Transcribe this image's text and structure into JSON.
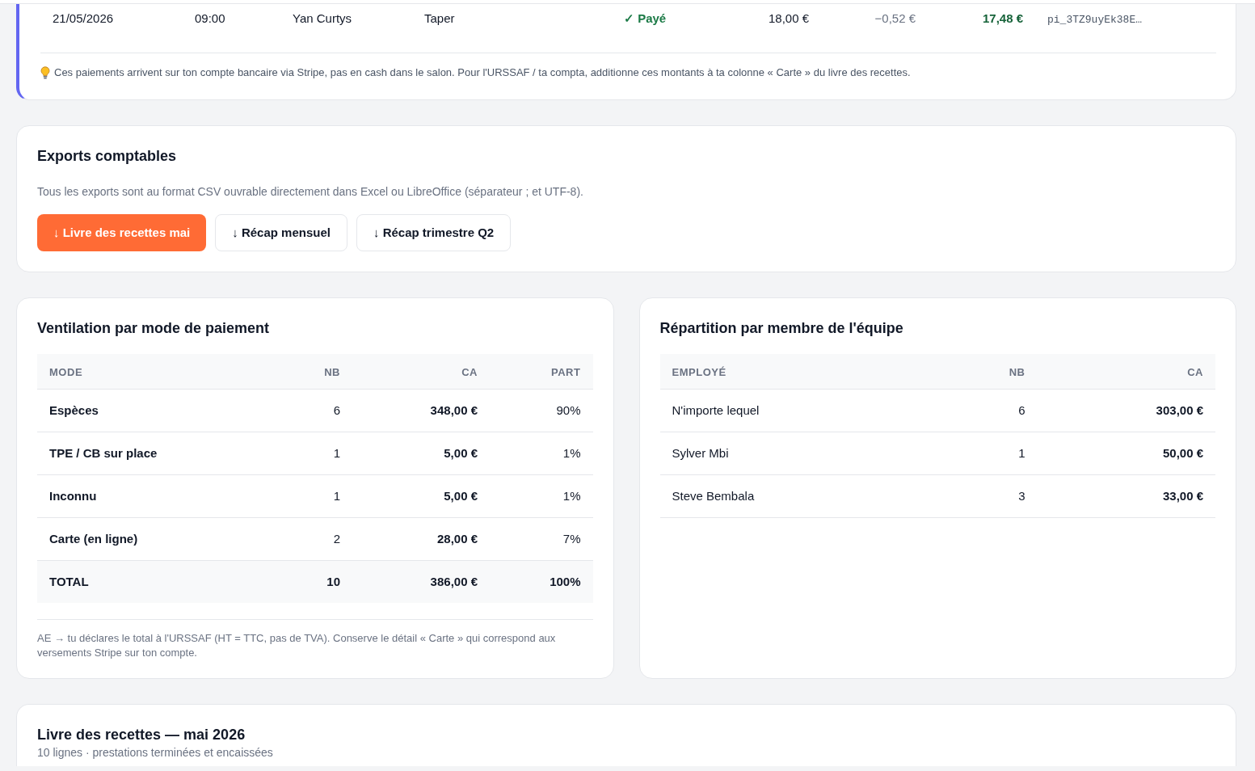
{
  "stripe_payments": {
    "rows": [
      {
        "cells": [
          {
            "text": "21/05/2026",
            "kind": "text"
          },
          {
            "text": "09:00",
            "kind": "text"
          },
          {
            "text": "Yan Curtys",
            "kind": "text"
          },
          {
            "text": "Taper",
            "kind": "text"
          },
          {
            "text": "✓ Payé",
            "kind": "status"
          },
          {
            "text": "18,00 €",
            "kind": "amount"
          },
          {
            "text": "−0,52 €",
            "kind": "fee"
          },
          {
            "text": "17,48 €",
            "kind": "net"
          },
          {
            "text": "pi_3TZ9uyEk38E…",
            "kind": "ref"
          }
        ]
      }
    ],
    "note": "Ces paiements arrivent sur ton compte bancaire via Stripe, pas en cash dans le salon. Pour l'URSSAF / ta compta, additionne ces montants à ta colonne « Carte » du livre des recettes."
  },
  "exports": {
    "title": "Exports comptables",
    "description": "Tous les exports sont au format CSV ouvrable directement dans Excel ou LibreOffice (séparateur ; et UTF-8).",
    "buttons": [
      {
        "label": "↓ Livre des recettes mai",
        "primary": true
      },
      {
        "label": "↓ Récap mensuel",
        "primary": false
      },
      {
        "label": "↓ Récap trimestre Q2",
        "primary": false
      }
    ]
  },
  "payment_breakdown": {
    "title": "Ventilation par mode de paiement",
    "columns": [
      "MODE",
      "NB",
      "CA",
      "PART"
    ],
    "rows": [
      [
        "Espèces",
        "6",
        "348,00 €",
        "90%"
      ],
      [
        "TPE / CB sur place",
        "1",
        "5,00 €",
        "1%"
      ],
      [
        "Inconnu",
        "1",
        "5,00 €",
        "1%"
      ],
      [
        "Carte (en ligne)",
        "2",
        "28,00 €",
        "7%"
      ]
    ],
    "total": [
      "TOTAL",
      "10",
      "386,00 €",
      "100%"
    ],
    "note": "AE → tu déclares le total à l'URSSAF (HT = TTC, pas de TVA). Conserve le détail « Carte » qui correspond aux versements Stripe sur ton compte."
  },
  "team_breakdown": {
    "title": "Répartition par membre de l'équipe",
    "columns": [
      "EMPLOYÉ",
      "NB",
      "CA"
    ],
    "rows": [
      [
        "N'importe lequel",
        "6",
        "303,00 €"
      ],
      [
        "Sylver Mbi",
        "1",
        "50,00 €"
      ],
      [
        "Steve Bembala",
        "3",
        "33,00 €"
      ]
    ]
  },
  "ledger": {
    "title": "Livre des recettes — mai 2026",
    "subtitle": "10 lignes · prestations terminées et encaissées"
  }
}
